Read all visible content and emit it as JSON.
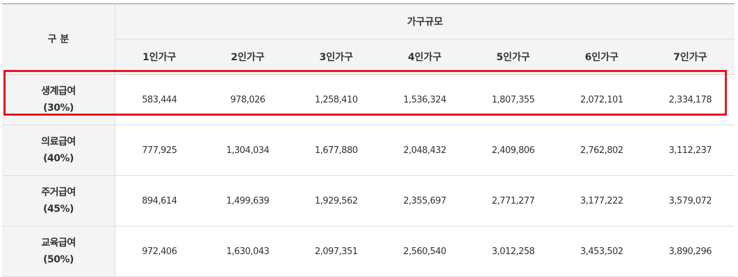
{
  "table": {
    "corner_label": "구 분",
    "group_header": "가구규모",
    "columns": [
      "1인가구",
      "2인가구",
      "3인가구",
      "4인가구",
      "5인가구",
      "6인가구",
      "7인가구"
    ],
    "rows": [
      {
        "name": "생계급여",
        "rate": "(30%)",
        "values": [
          "583,444",
          "978,026",
          "1,258,410",
          "1,536,324",
          "1,807,355",
          "2,072,101",
          "2,334,178"
        ]
      },
      {
        "name": "의료급여",
        "rate": "(40%)",
        "values": [
          "777,925",
          "1,304,034",
          "1,677,880",
          "2,048,432",
          "2,409,806",
          "2,762,802",
          "3,112,237"
        ]
      },
      {
        "name": "주거급여",
        "rate": "(45%)",
        "values": [
          "894,614",
          "1,499,639",
          "1,929,562",
          "2,355,697",
          "2,771,277",
          "3,177,222",
          "3,579,072"
        ]
      },
      {
        "name": "교육급여",
        "rate": "(50%)",
        "values": [
          "972,406",
          "1,630,043",
          "2,097,351",
          "2,560,540",
          "3,012,258",
          "3,453,502",
          "3,890,296"
        ]
      }
    ]
  },
  "highlight_color": "#e5161d"
}
